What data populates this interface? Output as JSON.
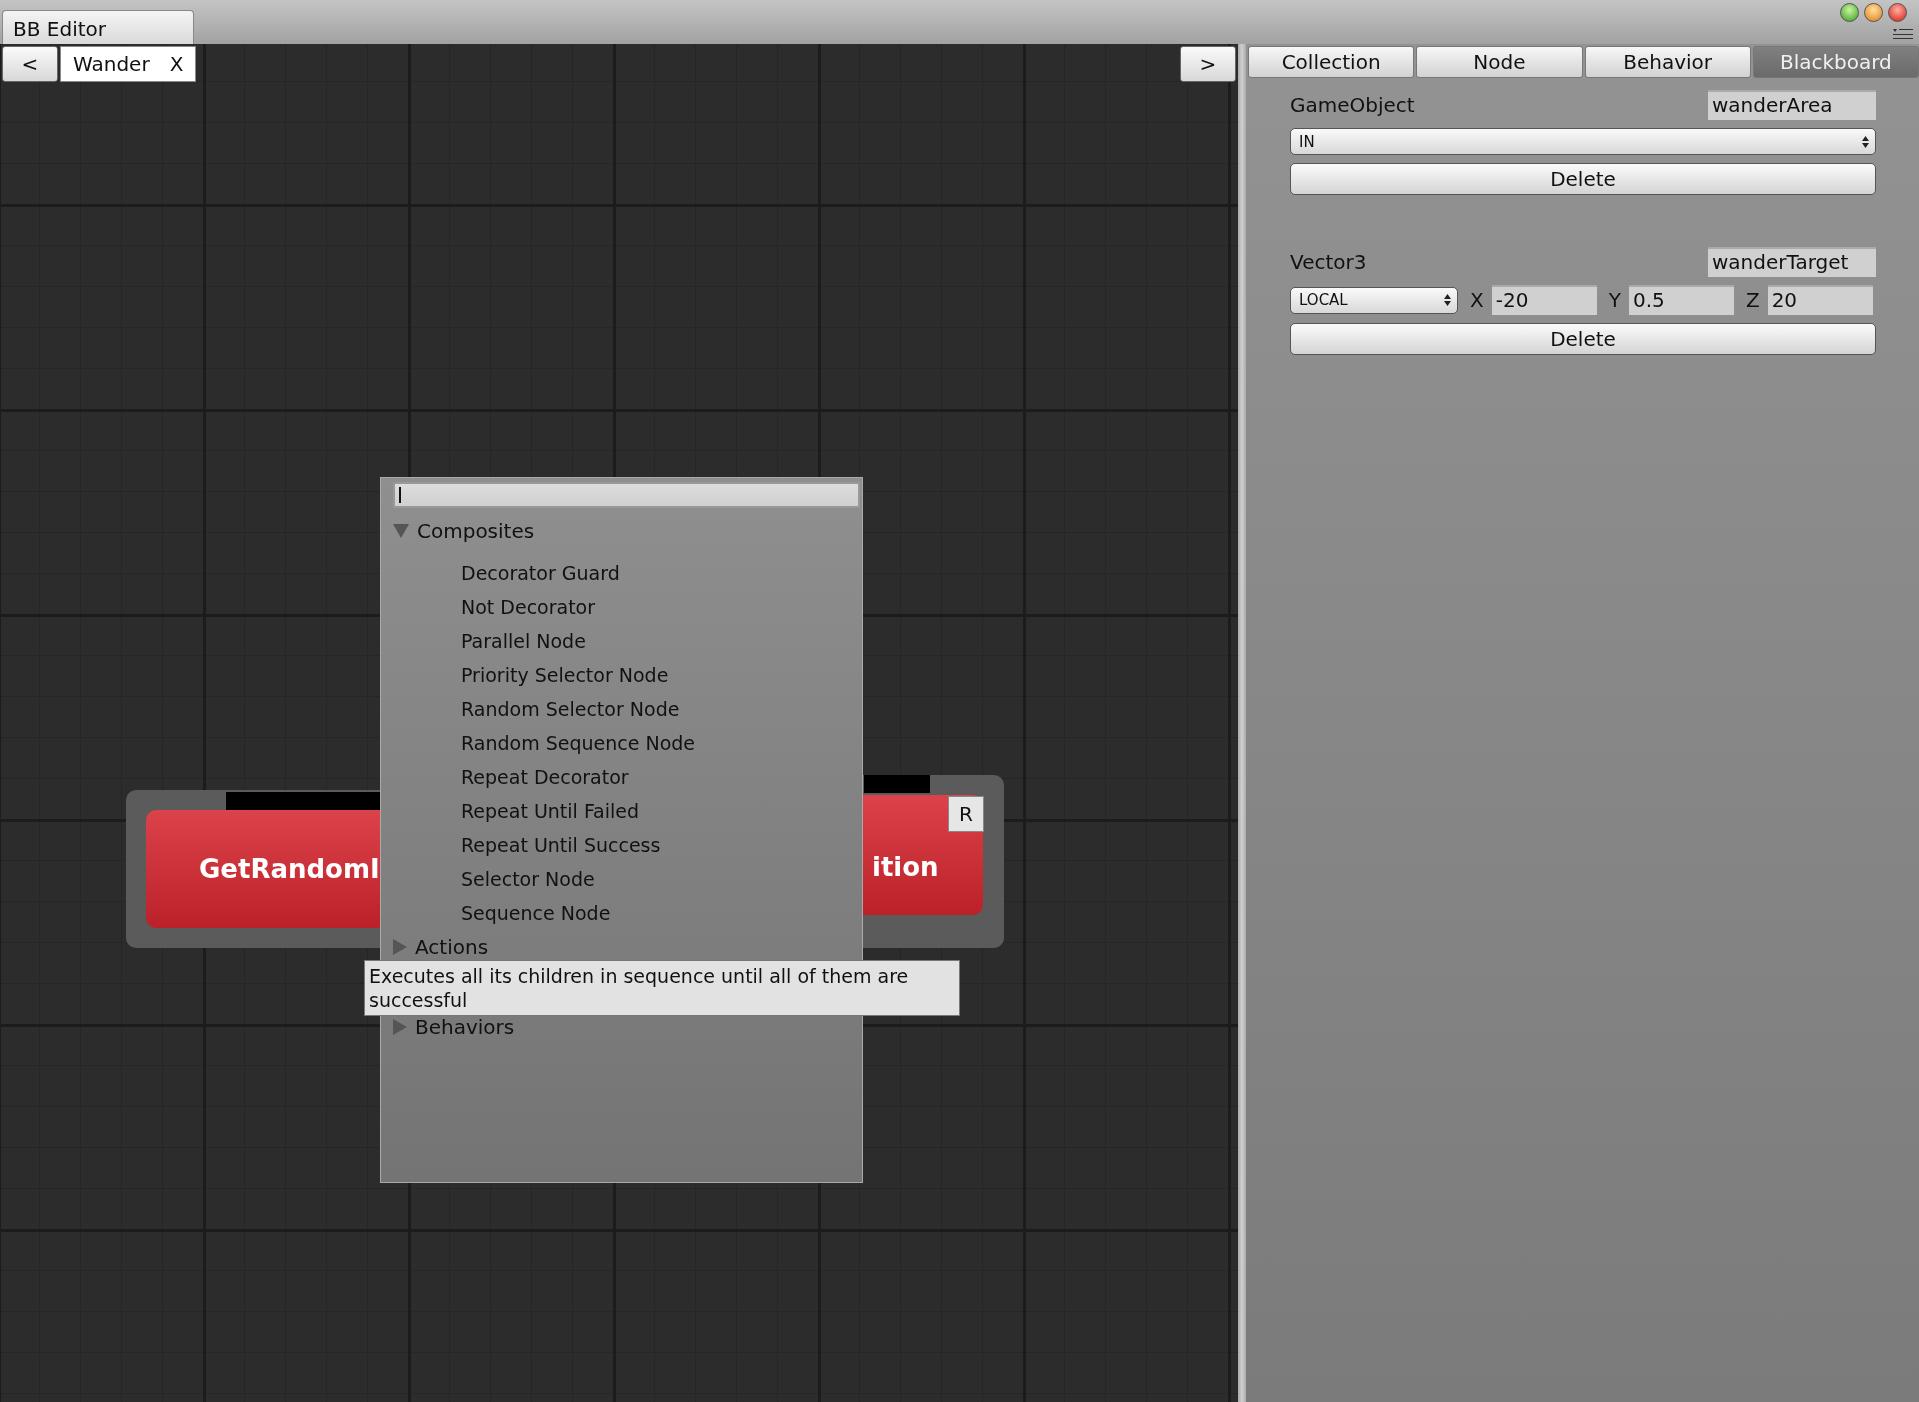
{
  "window": {
    "title": "BB Editor"
  },
  "toolbar": {
    "back": "<",
    "tab": {
      "label": "Wander",
      "close": "X"
    },
    "forward": ">"
  },
  "canvas": {
    "nodes": [
      {
        "label": "GetRandomI"
      },
      {
        "label": "ition",
        "badge": "R"
      }
    ]
  },
  "popup": {
    "categories": [
      {
        "label": "Composites",
        "expanded": true,
        "children": [
          "Decorator Guard",
          "Not Decorator",
          "Parallel Node",
          "Priority Selector Node",
          "Random Selector Node",
          "Random Sequence Node",
          "Repeat Decorator",
          "Repeat Until Failed",
          "Repeat Until Success",
          "Selector Node",
          "Sequence Node"
        ]
      },
      {
        "label": "Actions",
        "expanded": false
      },
      {
        "label": "Behaviors",
        "expanded": false
      }
    ],
    "tooltip": "Executes all its children in sequence until all of them are successful"
  },
  "panel": {
    "tabs": [
      {
        "label": "Collection",
        "selected": false
      },
      {
        "label": "Node",
        "selected": false
      },
      {
        "label": "Behavior",
        "selected": false
      },
      {
        "label": "Blackboard",
        "selected": true
      }
    ],
    "variables": [
      {
        "kind": "object",
        "type": "GameObject",
        "name": "wanderArea",
        "mode": "IN",
        "delete": "Delete"
      },
      {
        "kind": "vector",
        "type": "Vector3",
        "name": "wanderTarget",
        "mode": "LOCAL",
        "components": [
          {
            "axis": "X",
            "value": "-20"
          },
          {
            "axis": "Y",
            "value": "0.5"
          },
          {
            "axis": "Z",
            "value": "20"
          }
        ],
        "delete": "Delete"
      }
    ]
  }
}
